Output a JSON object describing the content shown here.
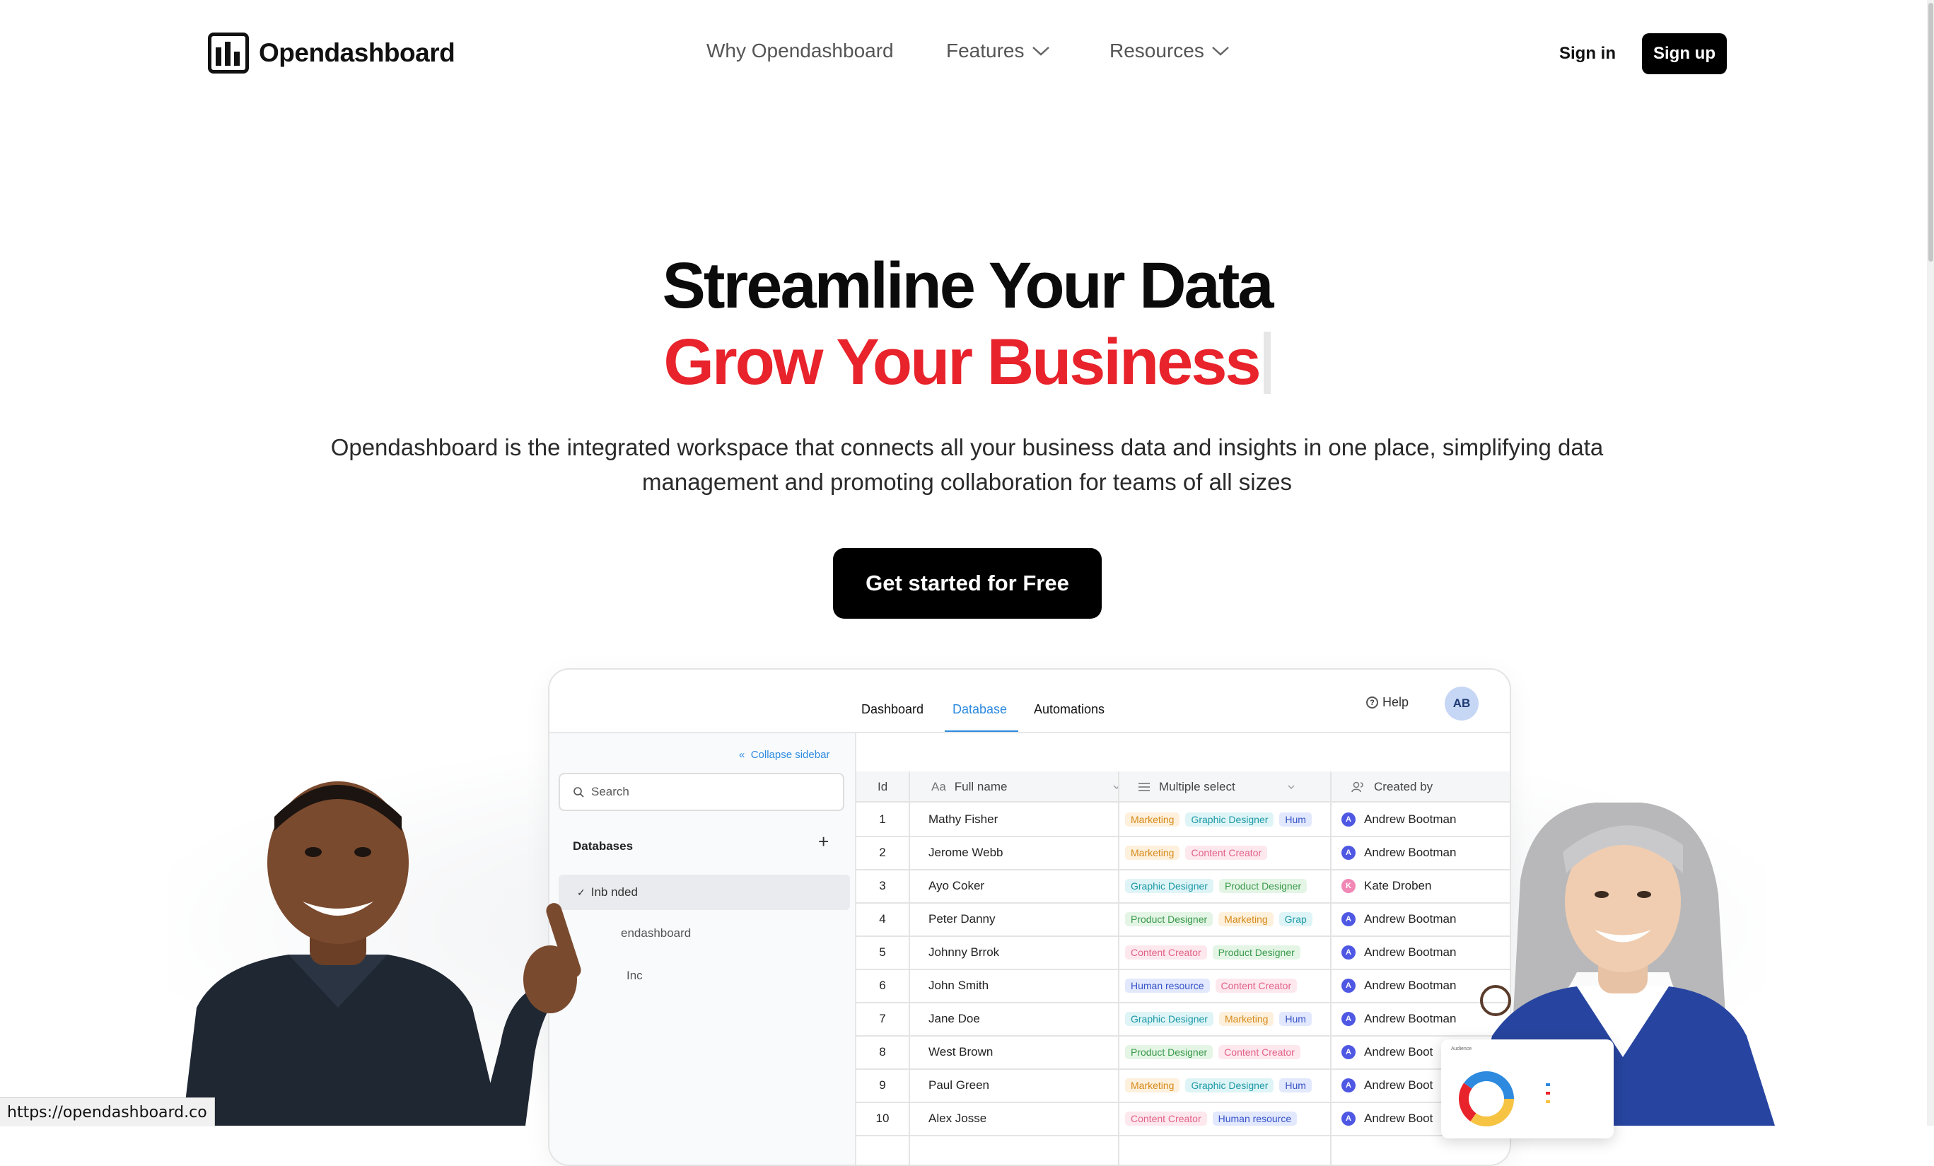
{
  "brand": {
    "name": "Opendashboard"
  },
  "nav": {
    "items": [
      {
        "label": "Why Opendashboard"
      },
      {
        "label": "Features"
      },
      {
        "label": "Resources"
      }
    ],
    "signin": "Sign in",
    "signup": "Sign up"
  },
  "hero": {
    "title_line1": "Streamline Your Data",
    "title_line2": "Grow Your Business",
    "subtitle": "Opendashboard is the integrated workspace that connects all your business data and insights in one place, simplifying data management and promoting collaboration for teams of all sizes",
    "cta": "Get started for Free"
  },
  "app": {
    "tabs": [
      "Dashboard",
      "Database",
      "Automations"
    ],
    "active_tab": "Database",
    "help": "Help",
    "avatar": "AB",
    "sidebar": {
      "collapse": "Collapse sidebar",
      "search_placeholder": "Search",
      "databases_label": "Databases",
      "items": [
        "Inb  nded",
        "endashboard",
        "Inc"
      ]
    },
    "table": {
      "columns": [
        "Id",
        "Full name",
        "Multiple select",
        "Created by"
      ],
      "full_name_prefix": "Aa",
      "rows": [
        {
          "id": "1",
          "name": "Mathy Fisher",
          "tags": [
            "Marketing",
            "Graphic Designer",
            "Hum"
          ],
          "creator": "Andrew Bootman",
          "initial": "A"
        },
        {
          "id": "2",
          "name": "Jerome Webb",
          "tags": [
            "Marketing",
            "Content Creator"
          ],
          "creator": "Andrew Bootman",
          "initial": "A"
        },
        {
          "id": "3",
          "name": "Ayo Coker",
          "tags": [
            "Graphic Designer",
            "Product Designer"
          ],
          "creator": "Kate Droben",
          "initial": "K"
        },
        {
          "id": "4",
          "name": "Peter Danny",
          "tags": [
            "Product Designer",
            "Marketing",
            "Grap"
          ],
          "creator": "Andrew Bootman",
          "initial": "A"
        },
        {
          "id": "5",
          "name": "Johnny Brrok",
          "tags": [
            "Content Creator",
            "Product Designer"
          ],
          "creator": "Andrew Bootman",
          "initial": "A"
        },
        {
          "id": "6",
          "name": "John Smith",
          "tags": [
            "Human resource",
            "Content Creator"
          ],
          "creator": "Andrew Bootman",
          "initial": "A"
        },
        {
          "id": "7",
          "name": "Jane Doe",
          "tags": [
            "Graphic Designer",
            "Marketing",
            "Hum"
          ],
          "creator": "Andrew Bootman",
          "initial": "A"
        },
        {
          "id": "8",
          "name": "West Brown",
          "tags": [
            "Product Designer",
            "Content Creator"
          ],
          "creator": "Andrew Boot",
          "initial": "A"
        },
        {
          "id": "9",
          "name": "Paul Green",
          "tags": [
            "Marketing",
            "Graphic Designer",
            "Hum"
          ],
          "creator": "Andrew Boot",
          "initial": "A"
        },
        {
          "id": "10",
          "name": "Alex Josse",
          "tags": [
            "Content Creator",
            "Human resource"
          ],
          "creator": "Andrew Boot",
          "initial": "A"
        }
      ]
    },
    "mini_card_title": "Audience"
  },
  "status_url": "https://opendashboard.co",
  "colors": {
    "accent_red": "#e8232b",
    "link_blue": "#2d8adf",
    "black": "#000000"
  }
}
